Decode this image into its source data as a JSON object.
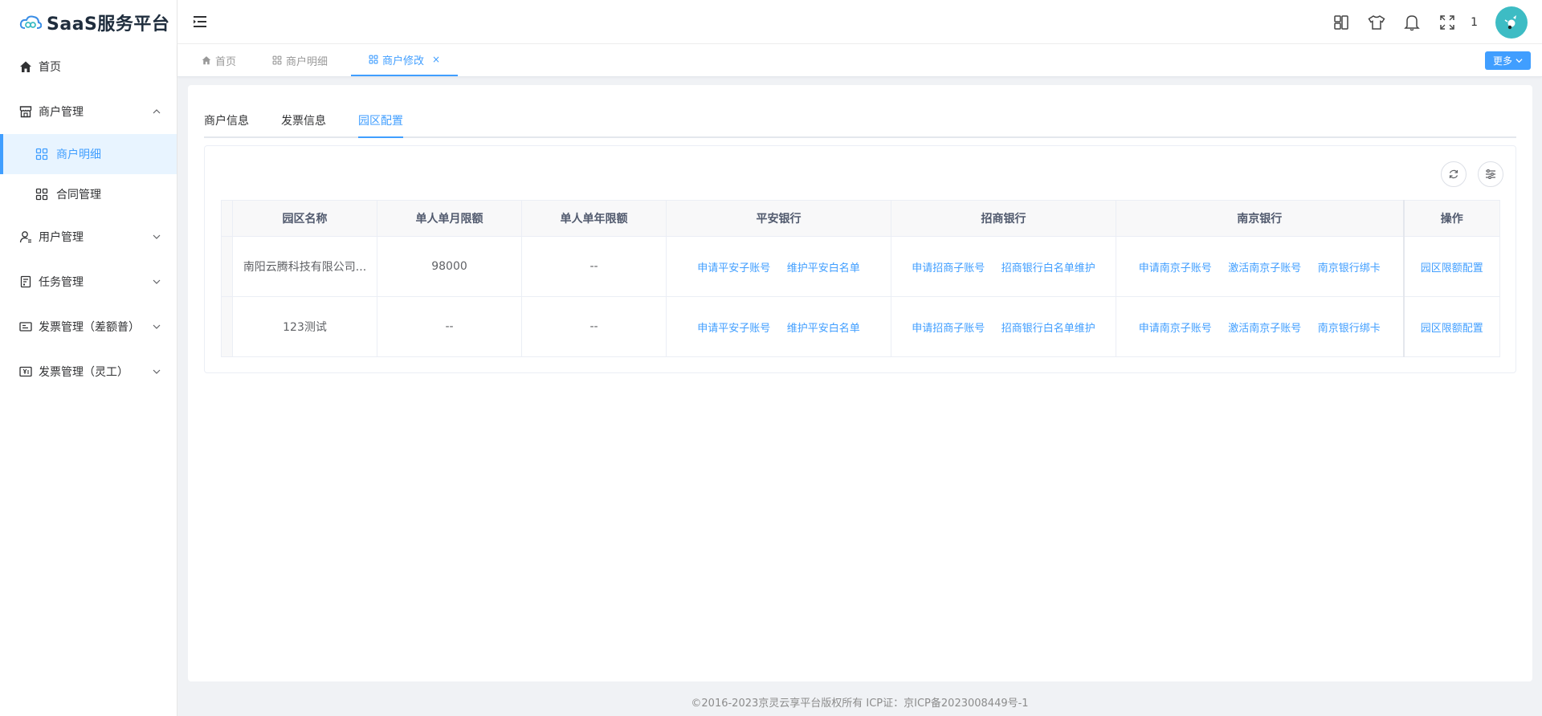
{
  "app": {
    "title": "SaaS服务平台"
  },
  "sidebar": {
    "home": "首页",
    "merchant_mgmt": "商户管理",
    "merchant_detail": "商户明细",
    "contract_mgmt": "合同管理",
    "user_mgmt": "用户管理",
    "task_mgmt": "任务管理",
    "invoice_mgmt_diff": "发票管理（差额普）",
    "invoice_mgmt_flex": "发票管理（灵工）"
  },
  "header": {
    "count": "1"
  },
  "tags": {
    "home": "首页",
    "merchant_detail": "商户明细",
    "merchant_edit": "商户修改",
    "close": "×",
    "more": "更多"
  },
  "tabs": {
    "merchant_info": "商户信息",
    "invoice_info": "发票信息",
    "park_config": "园区配置"
  },
  "table": {
    "headers": [
      "园区名称",
      "单人单月限额",
      "单人单年限额",
      "平安银行",
      "招商银行",
      "南京银行",
      "操作"
    ],
    "rows": [
      {
        "name": "南阳云腾科技有限公司...",
        "monthly": "98000",
        "yearly": "--",
        "pingan": [
          "申请平安子账号",
          "维护平安白名单"
        ],
        "cmb": [
          "申请招商子账号",
          "招商银行白名单维护"
        ],
        "nanjing": [
          "申请南京子账号",
          "激活南京子账号",
          "南京银行绑卡"
        ],
        "action": "园区限额配置"
      },
      {
        "name": "123测试",
        "monthly": "--",
        "yearly": "--",
        "pingan": [
          "申请平安子账号",
          "维护平安白名单"
        ],
        "cmb": [
          "申请招商子账号",
          "招商银行白名单维护"
        ],
        "nanjing": [
          "申请南京子账号",
          "激活南京子账号",
          "南京银行绑卡"
        ],
        "action": "园区限额配置"
      }
    ]
  },
  "footer": {
    "text": "©2016-2023京灵云享平台版权所有 ICP证：京ICP备2023008449号-1"
  },
  "colors": {
    "primary": "#409eff",
    "avatar": "#3dbcc4"
  }
}
